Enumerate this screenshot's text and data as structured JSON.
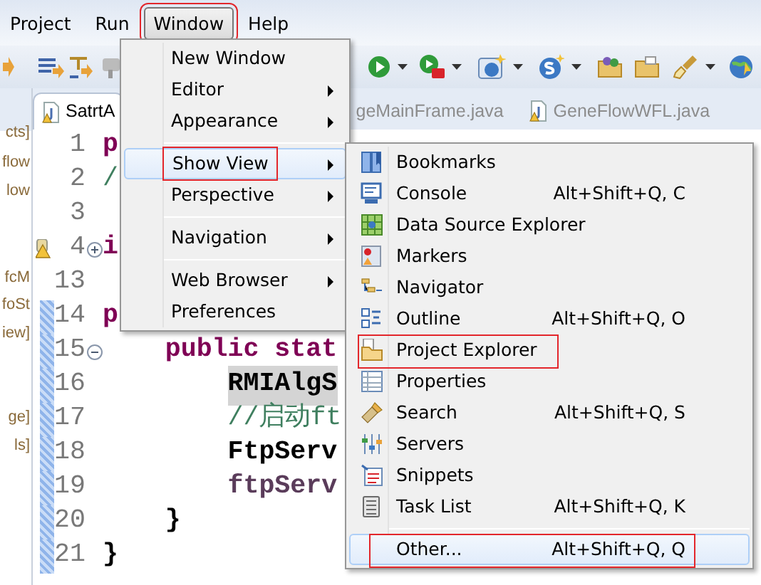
{
  "menubar": [
    {
      "label": "Project",
      "selected": false,
      "annotated": false
    },
    {
      "label": "Run",
      "selected": false,
      "annotated": false
    },
    {
      "label": "Window",
      "selected": true,
      "annotated": true
    },
    {
      "label": "Help",
      "selected": false,
      "annotated": false
    }
  ],
  "explorer_fragments": [
    "cts]",
    "flow",
    "low",
    "fcM",
    "foSt",
    "iew]",
    "ge]",
    "ls]"
  ],
  "editor_tabs": [
    {
      "label": "SatrtA",
      "selected": true
    },
    {
      "label": "geMainFrame.java",
      "selected": false
    },
    {
      "label": "GeneFlowWFL.java",
      "selected": false
    }
  ],
  "code_lines": [
    {
      "number": "1",
      "text": "p",
      "kind": "keyword",
      "changed": false
    },
    {
      "number": "2",
      "text": "/",
      "kind": "comment",
      "changed": false
    },
    {
      "number": "3",
      "changed": false
    },
    {
      "number": "4",
      "text": "i",
      "kind": "keyword",
      "changed": false,
      "warning": true,
      "collapsed": true
    },
    {
      "number": "13",
      "changed": false
    },
    {
      "number": "14",
      "text": "p",
      "kind": "keyword",
      "changed": true
    },
    {
      "number": "15",
      "text": "    public stat",
      "kind": "keyword",
      "changed": true,
      "collapsed": false
    },
    {
      "number": "16",
      "text": "        RMIAlgS",
      "kind": "plain",
      "changed": true,
      "highlighted": true
    },
    {
      "number": "17",
      "text": "        //启动ft",
      "kind": "comment",
      "changed": true
    },
    {
      "number": "18",
      "text": "        FtpServ",
      "kind": "plain",
      "changed": true
    },
    {
      "number": "19",
      "text": "        ftpServ",
      "kind": "field",
      "changed": true
    },
    {
      "number": "20",
      "text": "    }",
      "kind": "plain",
      "changed": true
    },
    {
      "number": "21",
      "text": "}",
      "kind": "plain",
      "changed": true
    }
  ],
  "window_menu": {
    "items": [
      {
        "kind": "item",
        "label": "New Window",
        "submenu": false,
        "selected": false,
        "annotated": false
      },
      {
        "kind": "item",
        "label": "Editor",
        "submenu": true,
        "selected": false,
        "annotated": false
      },
      {
        "kind": "item",
        "label": "Appearance",
        "submenu": true,
        "selected": false,
        "annotated": false
      },
      {
        "kind": "separator"
      },
      {
        "kind": "item",
        "label": "Show View",
        "submenu": true,
        "selected": true,
        "annotated": true
      },
      {
        "kind": "item",
        "label": "Perspective",
        "submenu": true,
        "selected": false,
        "annotated": false
      },
      {
        "kind": "separator"
      },
      {
        "kind": "item",
        "label": "Navigation",
        "submenu": true,
        "selected": false,
        "annotated": false
      },
      {
        "kind": "separator"
      },
      {
        "kind": "item",
        "label": "Web Browser",
        "submenu": true,
        "selected": false,
        "annotated": false
      },
      {
        "kind": "item",
        "label": "Preferences",
        "submenu": false,
        "selected": false,
        "annotated": false
      }
    ]
  },
  "show_view_menu": {
    "items": [
      {
        "kind": "item",
        "label": "Bookmarks",
        "selected": false,
        "annotated": false
      },
      {
        "kind": "item",
        "label": "Console",
        "shortcut": "Alt+Shift+Q, C",
        "selected": false,
        "annotated": false
      },
      {
        "kind": "item",
        "label": "Data Source Explorer",
        "selected": false,
        "annotated": false
      },
      {
        "kind": "item",
        "label": "Markers",
        "selected": false,
        "annotated": false
      },
      {
        "kind": "item",
        "label": "Navigator",
        "selected": false,
        "annotated": false
      },
      {
        "kind": "item",
        "label": "Outline",
        "shortcut": "Alt+Shift+Q, O",
        "selected": false,
        "annotated": false
      },
      {
        "kind": "item",
        "label": "Project Explorer",
        "selected": false,
        "annotated": true
      },
      {
        "kind": "item",
        "label": "Properties",
        "selected": false,
        "annotated": false
      },
      {
        "kind": "item",
        "label": "Search",
        "shortcut": "Alt+Shift+Q, S",
        "selected": false,
        "annotated": false
      },
      {
        "kind": "item",
        "label": "Servers",
        "selected": false,
        "annotated": false
      },
      {
        "kind": "item",
        "label": "Snippets",
        "selected": false,
        "annotated": false
      },
      {
        "kind": "item",
        "label": "Task List",
        "shortcut": "Alt+Shift+Q, K",
        "selected": false,
        "annotated": false
      },
      {
        "kind": "separator"
      },
      {
        "kind": "item",
        "label": "Other...",
        "shortcut": "Alt+Shift+Q, Q",
        "selected": true,
        "annotated": true
      }
    ]
  }
}
